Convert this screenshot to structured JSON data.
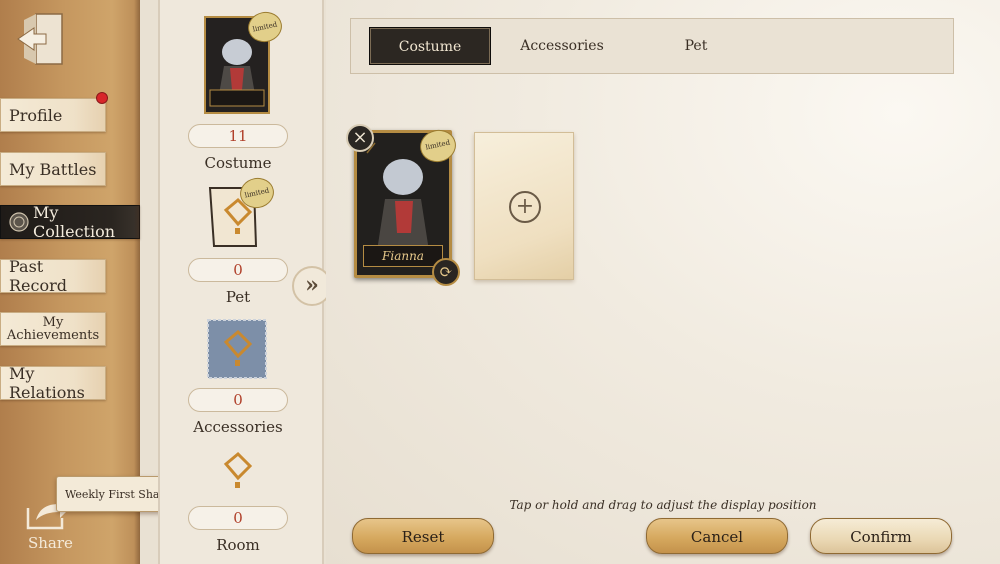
{
  "nav": {
    "items": [
      {
        "label": "Profile"
      },
      {
        "label": "My Battles"
      },
      {
        "label": "My Collection"
      },
      {
        "label": "Past Record"
      },
      {
        "label_line1": "My",
        "label_line2": "Achievements"
      },
      {
        "label": "My Relations"
      }
    ],
    "share_label": "Share",
    "tooltip": "Weekly First Share"
  },
  "categories": [
    {
      "count": "11",
      "label": "Costume",
      "card_name": "Fianna",
      "tag": "limited"
    },
    {
      "count": "0",
      "label": "Pet",
      "tag": "limited"
    },
    {
      "count": "0",
      "label": "Accessories"
    },
    {
      "count": "0",
      "label": "Room"
    }
  ],
  "tabs": [
    {
      "label": "Costume"
    },
    {
      "label": "Accessories"
    },
    {
      "label": "Pet"
    }
  ],
  "display": {
    "card_name": "Fianna",
    "tag": "limited",
    "hint": "Tap or hold and drag to adjust the display position"
  },
  "buttons": {
    "reset": "Reset",
    "cancel": "Cancel",
    "confirm": "Confirm"
  },
  "icons": {
    "exit": "exit-icon",
    "share": "share-icon",
    "puzzle": "puzzle-icon",
    "expand": "double-chevron-right-icon",
    "remove": "close-icon",
    "swap": "refresh-icon",
    "add": "plus-icon"
  },
  "colors": {
    "nav_bg": "#c5975f",
    "active_dark": "#2c2722",
    "gold": "#b58c43",
    "count_red": "#b0402a",
    "badge_red": "#d8262a"
  }
}
